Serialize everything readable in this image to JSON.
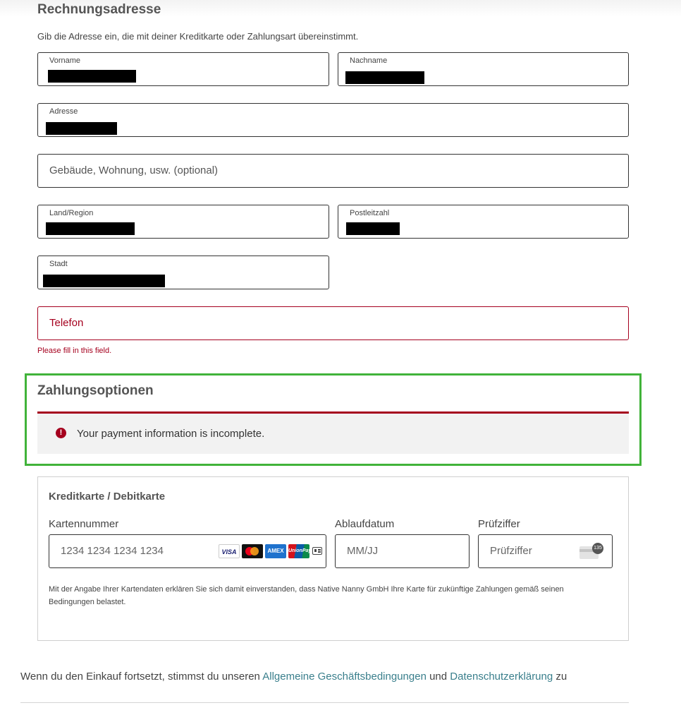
{
  "billing": {
    "title": "Rechnungsadresse",
    "subtitle": "Gib die Adresse ein, die mit deiner Kreditkarte oder Zahlungsart übereinstimmt.",
    "first_name_label": "Vorname",
    "last_name_label": "Nachname",
    "address_label": "Adresse",
    "building_placeholder": "Gebäude, Wohnung, usw. (optional)",
    "country_label": "Land/Region",
    "postal_label": "Postleitzahl",
    "city_label": "Stadt",
    "phone_placeholder": "Telefon",
    "phone_error": "Please fill in this field."
  },
  "payment": {
    "title": "Zahlungsoptionen",
    "alert": "Your payment information is incomplete.",
    "method_title": "Kreditkarte / Debitkarte",
    "card_number_label": "Kartennummer",
    "card_number_placeholder": "1234 1234 1234 1234",
    "expiry_label": "Ablaufdatum",
    "expiry_placeholder": "MM/JJ",
    "cvc_label": "Prüfziffer",
    "cvc_placeholder": "Prüfziffer",
    "cvc_badge": "135",
    "brands": {
      "visa": "VISA",
      "amex": "AMEX",
      "unionpay": "UnionPay"
    },
    "consent": "Mit der Angabe Ihrer Kartendaten erklären Sie sich damit einverstanden, dass Native Nanny GmbH Ihre Karte für zukünftige Zahlungen gemäß seinen Bedingungen belastet."
  },
  "terms": {
    "prefix": "Wenn du den Einkauf fortsetzt, stimmst du unseren",
    "agb_link": "Allgemeine Geschäftsbedingungen",
    "middle": "und",
    "privacy_link": "Datenschutzerklärung",
    "suffix": "zu"
  },
  "colors": {
    "error": "#a5001e",
    "highlight": "#41b33a",
    "link": "#3a7f8c"
  }
}
